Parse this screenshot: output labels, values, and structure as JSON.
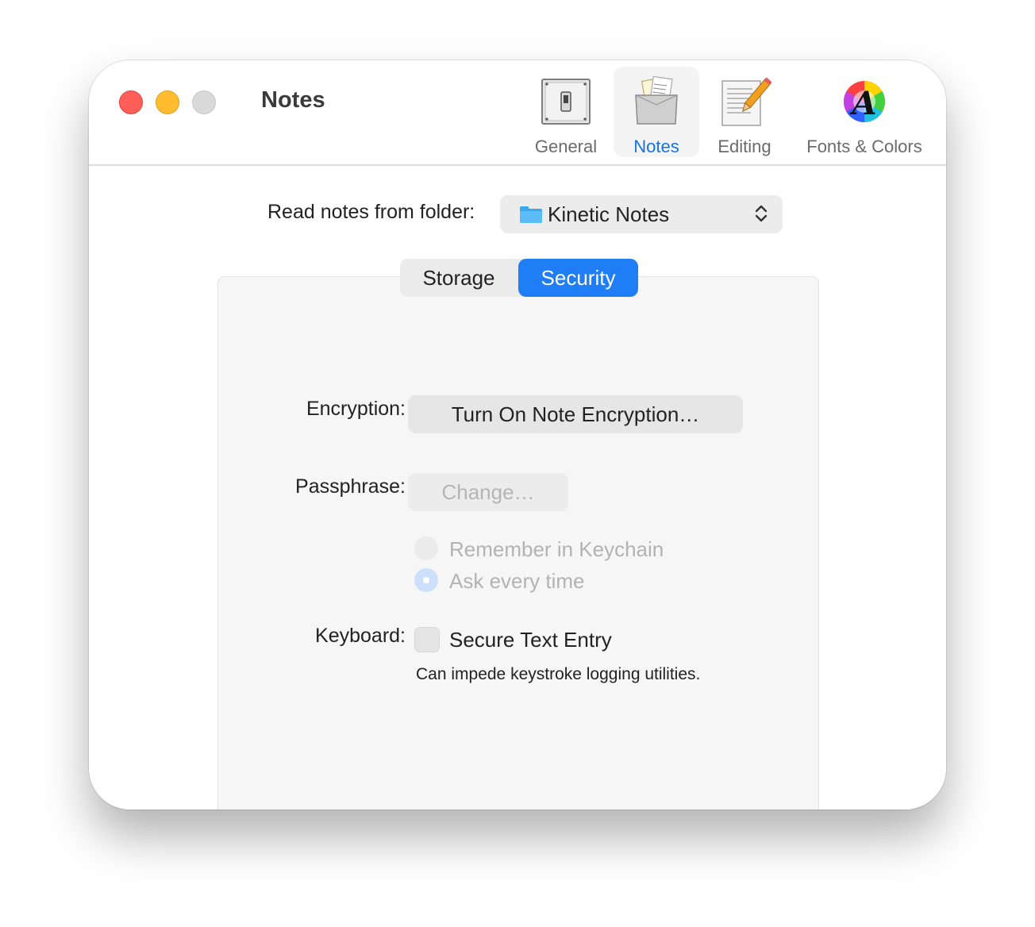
{
  "window": {
    "title": "Notes"
  },
  "toolbar": {
    "items": [
      {
        "label": "General",
        "icon": "switch-icon"
      },
      {
        "label": "Notes",
        "icon": "notes-bag-icon",
        "selected": true
      },
      {
        "label": "Editing",
        "icon": "document-pencil-icon"
      },
      {
        "label": "Fonts & Colors",
        "icon": "color-font-icon"
      }
    ]
  },
  "folder": {
    "label": "Read notes from folder:",
    "value": "Kinetic Notes",
    "icon": "folder-icon"
  },
  "tabs": {
    "storage": "Storage",
    "security": "Security",
    "selected": "Security"
  },
  "security": {
    "encryption_label": "Encryption:",
    "encryption_button": "Turn On Note Encryption…",
    "passphrase_label": "Passphrase:",
    "change_button": "Change…",
    "radio_remember": "Remember in Keychain",
    "radio_ask": "Ask every time",
    "keyboard_label": "Keyboard:",
    "secure_entry": "Secure Text Entry",
    "help": "Can impede keystroke logging utilities."
  },
  "colors": {
    "accent": "#1f7ef5",
    "close": "#ff5f57",
    "minimize": "#febc2e",
    "zoom": "#d9d9d9"
  }
}
